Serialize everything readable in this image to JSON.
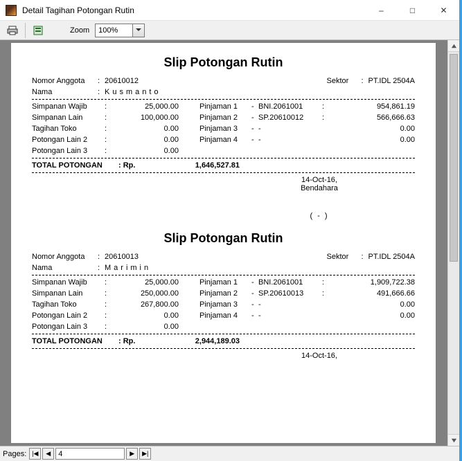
{
  "window": {
    "title": "Detail Tagihan Potongan Rutin"
  },
  "toolbar": {
    "zoom_label": "Zoom",
    "zoom_value": "100%"
  },
  "statusbar": {
    "pages_label": "Pages:",
    "current_page": "4"
  },
  "labels": {
    "nomor_anggota": "Nomor Anggota",
    "nama": "Nama",
    "sektor": "Sektor",
    "simpanan_wajib": "Simpanan Wajib",
    "simpanan_lain": "Simpanan Lain",
    "tagihan_toko": "Tagihan Toko",
    "potongan_lain_2": "Potongan Lain 2",
    "potongan_lain_3": "Potongan Lain 3",
    "pinjaman_1": "Pinjaman 1",
    "pinjaman_2": "Pinjaman 2",
    "pinjaman_3": "Pinjaman 3",
    "pinjaman_4": "Pinjaman 4",
    "total_potongan": "TOTAL POTONGAN",
    "rp": ": Rp.",
    "bendahara": "Bendahara",
    "sign_paren": "( - )"
  },
  "slips": [
    {
      "title": "Slip Potongan Rutin",
      "nomor_anggota": "20610012",
      "nama": "Kusmanto",
      "sektor": "PT.IDL 2504A",
      "simpanan_wajib": "25,000.00",
      "simpanan_lain": "100,000.00",
      "tagihan_toko": "0.00",
      "potongan_lain_2": "0.00",
      "potongan_lain_3": "0.00",
      "pinjaman_1_desc": "BNI.2061001",
      "pinjaman_1_val": "954,861.19",
      "pinjaman_2_desc": "SP.20610012",
      "pinjaman_2_val": "566,666.63",
      "pinjaman_3_desc": "-",
      "pinjaman_3_val": "0.00",
      "pinjaman_4_desc": "-",
      "pinjaman_4_val": "0.00",
      "total": "1,646,527.81",
      "date": "14-Oct-16,"
    },
    {
      "title": "Slip Potongan Rutin",
      "nomor_anggota": "20610013",
      "nama": "Marimin",
      "sektor": "PT.IDL 2504A",
      "simpanan_wajib": "25,000.00",
      "simpanan_lain": "250,000.00",
      "tagihan_toko": "267,800.00",
      "potongan_lain_2": "0.00",
      "potongan_lain_3": "0.00",
      "pinjaman_1_desc": "BNI.2061001",
      "pinjaman_1_val": "1,909,722.38",
      "pinjaman_2_desc": "SP.20610013",
      "pinjaman_2_val": "491,666.66",
      "pinjaman_3_desc": "-",
      "pinjaman_3_val": "0.00",
      "pinjaman_4_desc": "-",
      "pinjaman_4_val": "0.00",
      "total": "2,944,189.03",
      "date": "14-Oct-16,"
    }
  ]
}
